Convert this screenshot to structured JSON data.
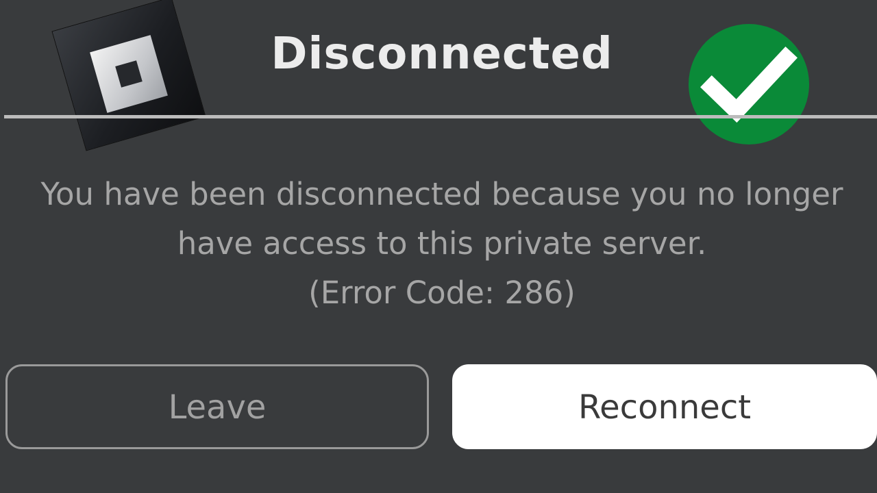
{
  "dialog": {
    "title": "Disconnected",
    "message_line_1": "You have been disconnected because you no longer",
    "message_line_2": "have access to this private server.",
    "error_code_text": "(Error Code: 286)"
  },
  "buttons": {
    "leave_label": "Leave",
    "reconnect_label": "Reconnect"
  },
  "icons": {
    "logo": "roblox-logo-icon",
    "badge": "checkmark-icon"
  },
  "colors": {
    "background": "#393b3d",
    "title_text": "#ececec",
    "message_text": "#a6a6a6",
    "divider": "#bcbcbc",
    "check_badge": "#0a8a38",
    "reconnect_bg": "#ffffff",
    "leave_border": "#9a9a9a"
  }
}
